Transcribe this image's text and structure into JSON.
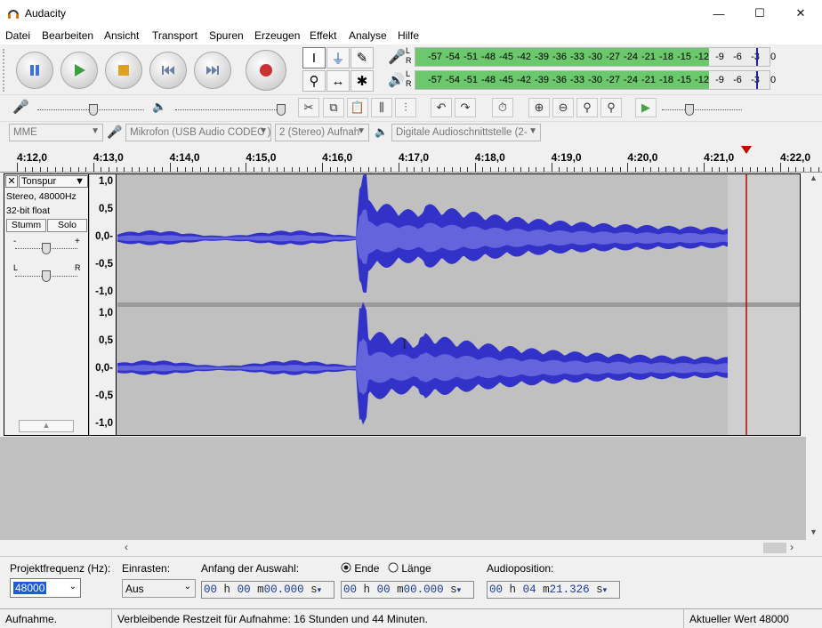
{
  "window": {
    "title": "Audacity",
    "minimize": "—",
    "maximize": "☐",
    "close": "✕"
  },
  "menu": [
    "Datei",
    "Bearbeiten",
    "Ansicht",
    "Transport",
    "Spuren",
    "Erzeugen",
    "Effekt",
    "Analyse",
    "Hilfe"
  ],
  "meters": {
    "ticks": [
      "-57",
      "-54",
      "-51",
      "-48",
      "-45",
      "-42",
      "-39",
      "-36",
      "-33",
      "-30",
      "-27",
      "-24",
      "-21",
      "-18",
      "-15",
      "-12",
      "-9",
      "-6",
      "-3",
      "0"
    ],
    "record_level": 0.83,
    "playback_level": 0.83,
    "channel_left": "L",
    "channel_right": "R",
    "record_color": "#6cc86c",
    "playback_color": "#6cc86c"
  },
  "device": {
    "host": "MME",
    "input": "Mikrofon (USB Audio CODEC )",
    "channels": "2 (Stereo) Aufnah",
    "output": "Digitale Audioschnittstelle (2-"
  },
  "timeline": {
    "labels": [
      "4:12,0",
      "4:13,0",
      "4:14,0",
      "4:15,0",
      "4:16,0",
      "4:17,0",
      "4:18,0",
      "4:19,0",
      "4:20,0",
      "4:21,0",
      "4:22,0"
    ]
  },
  "track": {
    "name": "Tonspur",
    "info1": "Stereo, 48000Hz",
    "info2": "32-bit float",
    "mute": "Stumm",
    "solo": "Solo",
    "gain_minus": "-",
    "gain_plus": "+",
    "pan_left": "L",
    "pan_right": "R",
    "close": "✕"
  },
  "vruler": [
    "1,0",
    "0,5",
    "0,0-",
    "-0,5",
    "-1,0"
  ],
  "bottom": {
    "rate_label": "Projektfrequenz (Hz):",
    "rate_value": "48000",
    "snap_label": "Einrasten:",
    "snap_value": "Aus",
    "sel_start_label": "Anfang der Auswahl:",
    "end_label": "Ende",
    "length_label": "Länge",
    "audio_pos_label": "Audioposition:",
    "sel_start": [
      "00",
      "h",
      "00",
      "m",
      "00.000",
      "s"
    ],
    "sel_end": [
      "00",
      "h",
      "00",
      "m",
      "00.000",
      "s"
    ],
    "audio_pos": [
      "00",
      "h",
      "04",
      "m",
      "21.326",
      "s"
    ]
  },
  "status": {
    "state": "Aufnahme.",
    "remaining": "Verbleibende Restzeit für Aufnahme: 16 Stunden und 44 Minuten.",
    "rate": "Aktueller Wert 48000"
  },
  "colors": {
    "waveform": "#3232c8",
    "waveform_rms": "#6464dc",
    "playhead": "#c00000",
    "selection_bg": "#c0c0c0"
  }
}
